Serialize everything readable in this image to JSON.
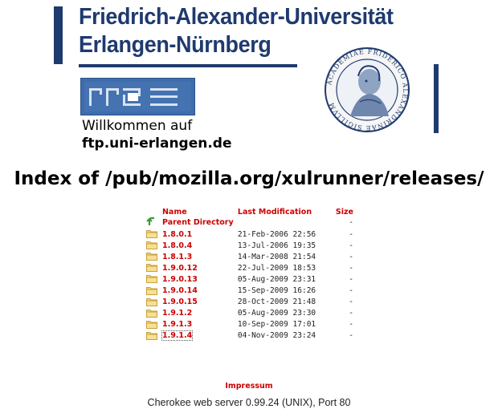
{
  "header": {
    "university_line1": "Friedrich-Alexander-Universität",
    "university_line2": "Erlangen-Nürnberg",
    "welcome": "Willkommen auf",
    "host": "ftp.uni-erlangen.de",
    "seal_text_top": "ACADEMIAE FRIDERICO",
    "seal_text_right": "ALEXANDRINAE",
    "seal_text_bottom": "SIGILLVM",
    "brand_color": "#1f3a6e"
  },
  "index_title": "Index of /pub/mozilla.org/xulrunner/releases/",
  "table": {
    "headers": {
      "name": "Name",
      "modified": "Last Modification",
      "size": "Size"
    },
    "parent": {
      "label": "Parent Directory",
      "size": "-"
    },
    "rows": [
      {
        "name": "1.8.0.1",
        "date": "21-Feb-2006 22:56",
        "size": "-"
      },
      {
        "name": "1.8.0.4",
        "date": "13-Jul-2006 19:35",
        "size": "-"
      },
      {
        "name": "1.8.1.3",
        "date": "14-Mar-2008 21:54",
        "size": "-"
      },
      {
        "name": "1.9.0.12",
        "date": "22-Jul-2009 18:53",
        "size": "-"
      },
      {
        "name": "1.9.0.13",
        "date": "05-Aug-2009 23:31",
        "size": "-"
      },
      {
        "name": "1.9.0.14",
        "date": "15-Sep-2009 16:26",
        "size": "-"
      },
      {
        "name": "1.9.0.15",
        "date": "28-Oct-2009 21:48",
        "size": "-"
      },
      {
        "name": "1.9.1.2",
        "date": "05-Aug-2009 23:30",
        "size": "-"
      },
      {
        "name": "1.9.1.3",
        "date": "10-Sep-2009 17:01",
        "size": "-"
      },
      {
        "name": "1.9.1.4",
        "date": "04-Nov-2009 23:24",
        "size": "-"
      }
    ],
    "link_color": "#cc0000",
    "folder_icon": "folder-icon",
    "parent_icon": "up-arrow-icon"
  },
  "footer": {
    "impressum": "Impressum",
    "server": "Cherokee web server 0.99.24 (UNIX), Port 80"
  }
}
